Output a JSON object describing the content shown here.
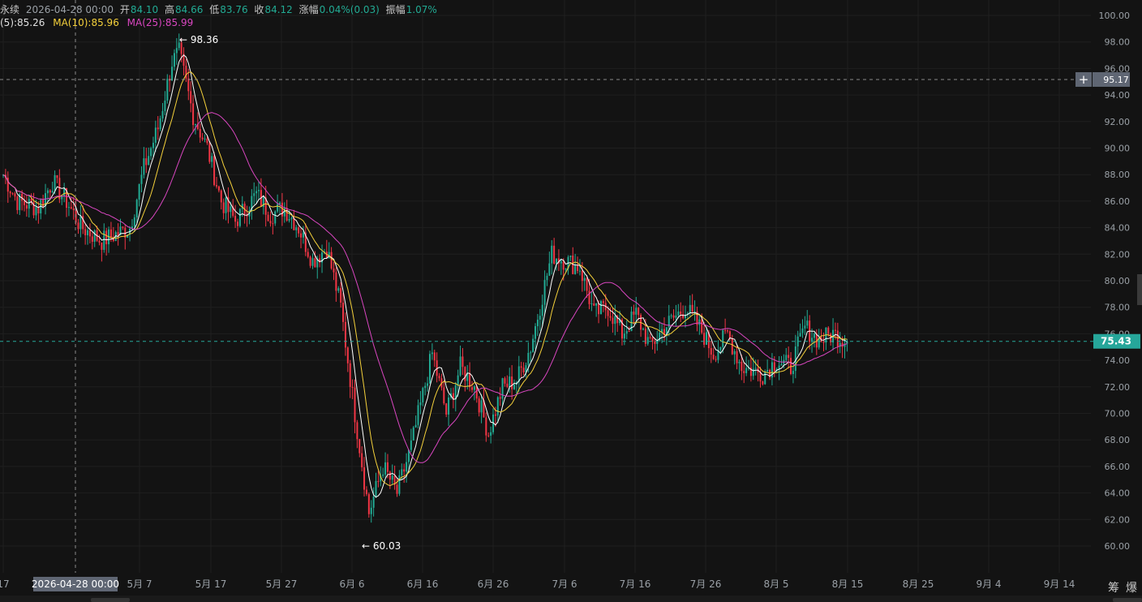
{
  "info": {
    "symbol_fragment": "永续",
    "datetime": "2026-04-28 00:00",
    "open_label": "开",
    "open": "84.10",
    "high_label": "高",
    "high": "84.66",
    "low_label": "低",
    "low": "83.76",
    "close_label": "收",
    "close": "84.12",
    "change_label": "涨幅",
    "change": "0.04%(0.03)",
    "amplitude_label": "振幅",
    "amplitude": "1.07%"
  },
  "ma": {
    "ma5_label": "(5):85.26",
    "ma10_label": "MA(10):85.96",
    "ma25_label": "MA(25):85.99"
  },
  "colors": {
    "background": "#131313",
    "grid": "#1f1f1f",
    "up": "#22ab94",
    "down": "#f23645",
    "ma5": "#ffffff",
    "ma10": "#f5d13b",
    "ma25": "#d946c0",
    "crosshair": "#8a8a8a",
    "price_tag": "#26a69a",
    "cursor_tag": "#5f6673",
    "axis_text": "#9aa0a6"
  },
  "crosshair": {
    "price_label": "95.17",
    "date_label": "2026-04-28 00:00",
    "plus_icon": "+"
  },
  "current_price": "75.43",
  "toolbar": {
    "tool1": "筹",
    "tool2": "爆"
  },
  "chart_data": {
    "type": "candlestick",
    "ylim": [
      60.0,
      100.0
    ],
    "y_ticks": [
      "100.00",
      "98.00",
      "96.00",
      "94.00",
      "92.00",
      "90.00",
      "88.00",
      "86.00",
      "84.00",
      "82.00",
      "80.00",
      "78.00",
      "76.00",
      "74.00",
      "72.00",
      "70.00",
      "68.00",
      "66.00",
      "64.00",
      "62.00",
      "60.00"
    ],
    "x_ticks": [
      "17",
      "5月 7",
      "5月 17",
      "5月 27",
      "6月 6",
      "6月 16",
      "6月 26",
      "7月 6",
      "7月 16",
      "7月 26",
      "8月 5",
      "8月 15",
      "8月 25",
      "9月 4",
      "9月 14"
    ],
    "annotations": [
      {
        "label": "98.36",
        "value": 98.36,
        "kind": "high"
      },
      {
        "label": "60.03",
        "value": 60.03,
        "kind": "low"
      }
    ],
    "price_path": [
      {
        "d": "04-17",
        "v": 88.0
      },
      {
        "d": "04-19",
        "v": 86.0
      },
      {
        "d": "04-22",
        "v": 85.5
      },
      {
        "d": "04-24",
        "v": 87.5
      },
      {
        "d": "04-26",
        "v": 86.0
      },
      {
        "d": "04-28",
        "v": 84.1
      },
      {
        "d": "05-01",
        "v": 83.0
      },
      {
        "d": "05-03",
        "v": 83.5
      },
      {
        "d": "05-05",
        "v": 84.0
      },
      {
        "d": "05-07",
        "v": 88.5
      },
      {
        "d": "05-09",
        "v": 91.5
      },
      {
        "d": "05-11",
        "v": 96.5
      },
      {
        "d": "05-12",
        "v": 97.2
      },
      {
        "d": "05-14",
        "v": 92.5
      },
      {
        "d": "05-16",
        "v": 90.0
      },
      {
        "d": "05-18",
        "v": 86.0
      },
      {
        "d": "05-20",
        "v": 84.5
      },
      {
        "d": "05-23",
        "v": 86.5
      },
      {
        "d": "05-25",
        "v": 85.0
      },
      {
        "d": "05-27",
        "v": 85.5
      },
      {
        "d": "05-29",
        "v": 84.0
      },
      {
        "d": "05-31",
        "v": 81.5
      },
      {
        "d": "06-02",
        "v": 82.5
      },
      {
        "d": "06-04",
        "v": 78.0
      },
      {
        "d": "06-06",
        "v": 70.0
      },
      {
        "d": "06-08",
        "v": 62.5
      },
      {
        "d": "06-10",
        "v": 66.0
      },
      {
        "d": "06-12",
        "v": 64.0
      },
      {
        "d": "06-14",
        "v": 67.5
      },
      {
        "d": "06-17",
        "v": 74.5
      },
      {
        "d": "06-19",
        "v": 70.0
      },
      {
        "d": "06-21",
        "v": 73.5
      },
      {
        "d": "06-23",
        "v": 72.0
      },
      {
        "d": "06-25",
        "v": 68.5
      },
      {
        "d": "06-27",
        "v": 72.0
      },
      {
        "d": "06-29",
        "v": 72.5
      },
      {
        "d": "07-01",
        "v": 75.0
      },
      {
        "d": "07-04",
        "v": 82.0
      },
      {
        "d": "07-06",
        "v": 81.5
      },
      {
        "d": "07-08",
        "v": 81.0
      },
      {
        "d": "07-10",
        "v": 77.5
      },
      {
        "d": "07-12",
        "v": 78.0
      },
      {
        "d": "07-14",
        "v": 76.0
      },
      {
        "d": "07-16",
        "v": 77.5
      },
      {
        "d": "07-18",
        "v": 75.0
      },
      {
        "d": "07-20",
        "v": 76.5
      },
      {
        "d": "07-23",
        "v": 78.0
      },
      {
        "d": "07-25",
        "v": 76.5
      },
      {
        "d": "07-27",
        "v": 74.5
      },
      {
        "d": "07-29",
        "v": 76.0
      },
      {
        "d": "07-31",
        "v": 73.5
      },
      {
        "d": "08-03",
        "v": 73.0
      },
      {
        "d": "08-05",
        "v": 74.0
      },
      {
        "d": "08-07",
        "v": 73.5
      },
      {
        "d": "08-09",
        "v": 76.5
      },
      {
        "d": "08-11",
        "v": 75.5
      },
      {
        "d": "08-13",
        "v": 76.0
      },
      {
        "d": "08-15",
        "v": 75.43
      }
    ]
  }
}
